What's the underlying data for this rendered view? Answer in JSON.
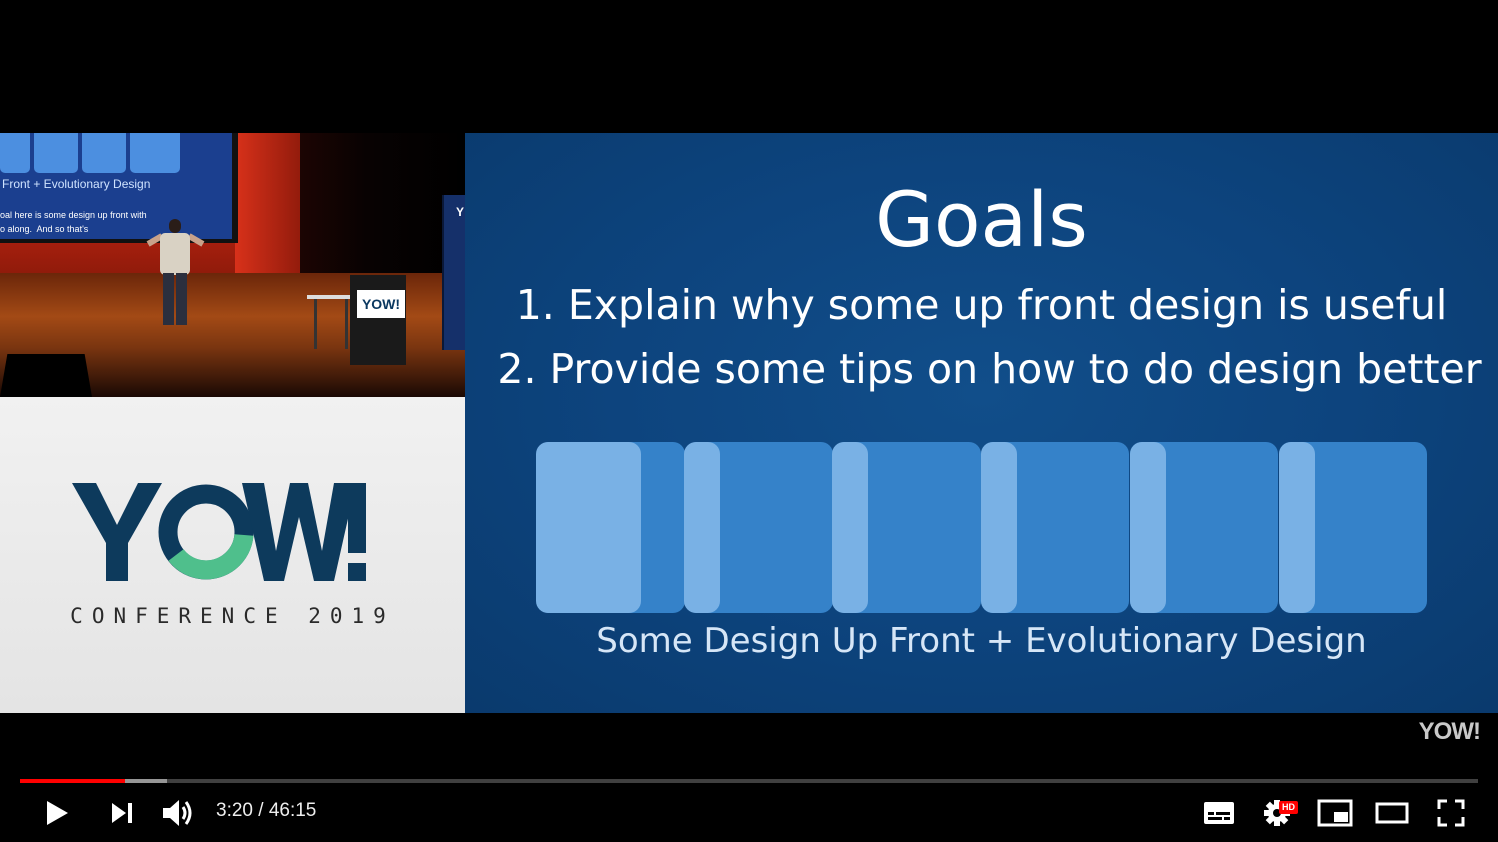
{
  "video": {
    "stage": {
      "screen_caption": "Front + Evolutionary Design",
      "screen_subtitle": "oal here is some design up front with\no along.  And so that's",
      "banner_text": "Y",
      "podium_sign": "YOW!"
    },
    "logo_panel": {
      "logo_text": "YOW!",
      "conference": "CONFERENCE 2019"
    },
    "slide": {
      "title": "Goals",
      "goals": [
        "1. Explain why some up front design is useful",
        "2. Provide some tips on how to do design better"
      ],
      "caption": "Some Design Up Front + Evolutionary Design"
    },
    "watermark": "YOW!",
    "colors": {
      "slide_bg": "#0d447e",
      "bar_dark": "#3582c9",
      "bar_light": "#79b1e5",
      "logo_navy": "#0d3a5c",
      "logo_green": "#4fbf8c",
      "progress_red": "#ff0000"
    }
  },
  "controls": {
    "current_time": "3:20",
    "duration": "46:15",
    "time_display": "3:20 / 46:15",
    "progress_fraction": 0.072,
    "buffered_fraction": 0.101,
    "hd_badge": "HD",
    "icons": [
      "play-icon",
      "next-icon",
      "volume-icon",
      "subtitles-icon",
      "settings-icon",
      "miniplayer-icon",
      "theater-icon",
      "fullscreen-icon"
    ]
  }
}
